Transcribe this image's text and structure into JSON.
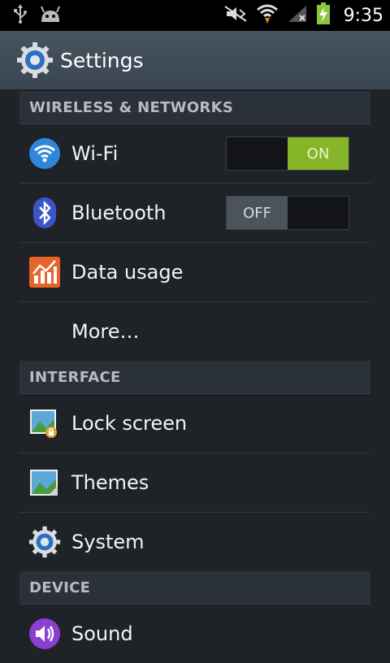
{
  "status_bar": {
    "time": "9:35",
    "icons": [
      "usb-icon",
      "android-debug-icon",
      "mute-icon",
      "wifi-icon",
      "signal-icon",
      "battery-charging-icon"
    ]
  },
  "action_bar": {
    "title": "Settings",
    "icon": "settings-gear-icon"
  },
  "sections": {
    "wireless": {
      "header": "WIRELESS & NETWORKS",
      "wifi": {
        "label": "Wi-Fi",
        "icon": "wifi-icon",
        "toggle": "ON"
      },
      "bluetooth": {
        "label": "Bluetooth",
        "icon": "bluetooth-icon",
        "toggle": "OFF"
      },
      "data_usage": {
        "label": "Data usage",
        "icon": "data-usage-icon"
      },
      "more": {
        "label": "More…"
      }
    },
    "interface": {
      "header": "INTERFACE",
      "lock_screen": {
        "label": "Lock screen",
        "icon": "lock-screen-icon"
      },
      "themes": {
        "label": "Themes",
        "icon": "themes-icon"
      },
      "system": {
        "label": "System",
        "icon": "system-gear-icon"
      }
    },
    "device": {
      "header": "DEVICE",
      "sound": {
        "label": "Sound",
        "icon": "sound-icon"
      }
    }
  },
  "colors": {
    "toggle_on": "#86b52a",
    "toggle_off": "#4b535b",
    "background": "#1f2226",
    "action_bar": "#3a4651"
  }
}
